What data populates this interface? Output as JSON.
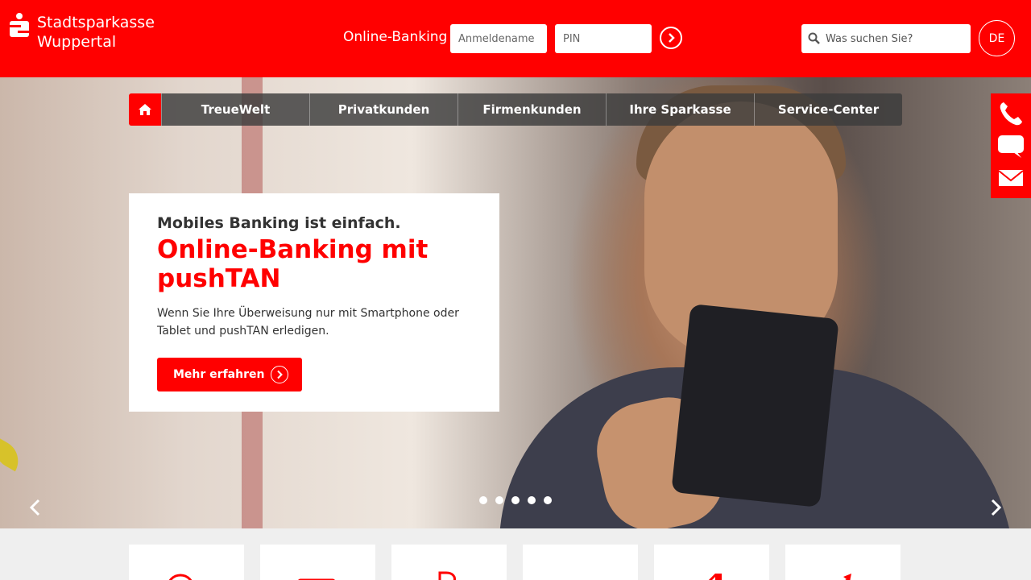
{
  "header": {
    "logo_line1": "Stadtsparkasse",
    "logo_line2": "Wuppertal",
    "online_banking_label": "Online-Banking",
    "username_placeholder": "Anmeldename",
    "pin_placeholder": "PIN",
    "search_placeholder": "Was suchen Sie?",
    "language": "DE"
  },
  "nav": {
    "items": [
      {
        "label": "TreueWelt"
      },
      {
        "label": "Privatkunden"
      },
      {
        "label": "Firmenkunden"
      },
      {
        "label": "Ihre Sparkasse"
      },
      {
        "label": "Service-Center"
      }
    ]
  },
  "teaser": {
    "kicker": "Mobiles Banking ist einfach.",
    "title": "Online-Banking mit pushTAN",
    "text": "Wenn Sie Ihre Überweisung nur mit Smartphone oder Tablet und pushTAN erledigen.",
    "button_label": "Mehr erfahren"
  },
  "slider": {
    "slide_count": 5,
    "active_index": 0
  },
  "side_contact": {
    "icons": [
      "phone-icon",
      "chat-icon",
      "mail-icon"
    ]
  },
  "tiles": {
    "icons": [
      "target-icon",
      "card-icon",
      "piggy-icon",
      "money-icon",
      "house-icon",
      "growth-icon"
    ]
  },
  "colors": {
    "brand": "#ff0000",
    "nav_bg": "#3c3c3c",
    "page_bg": "#efefef"
  }
}
